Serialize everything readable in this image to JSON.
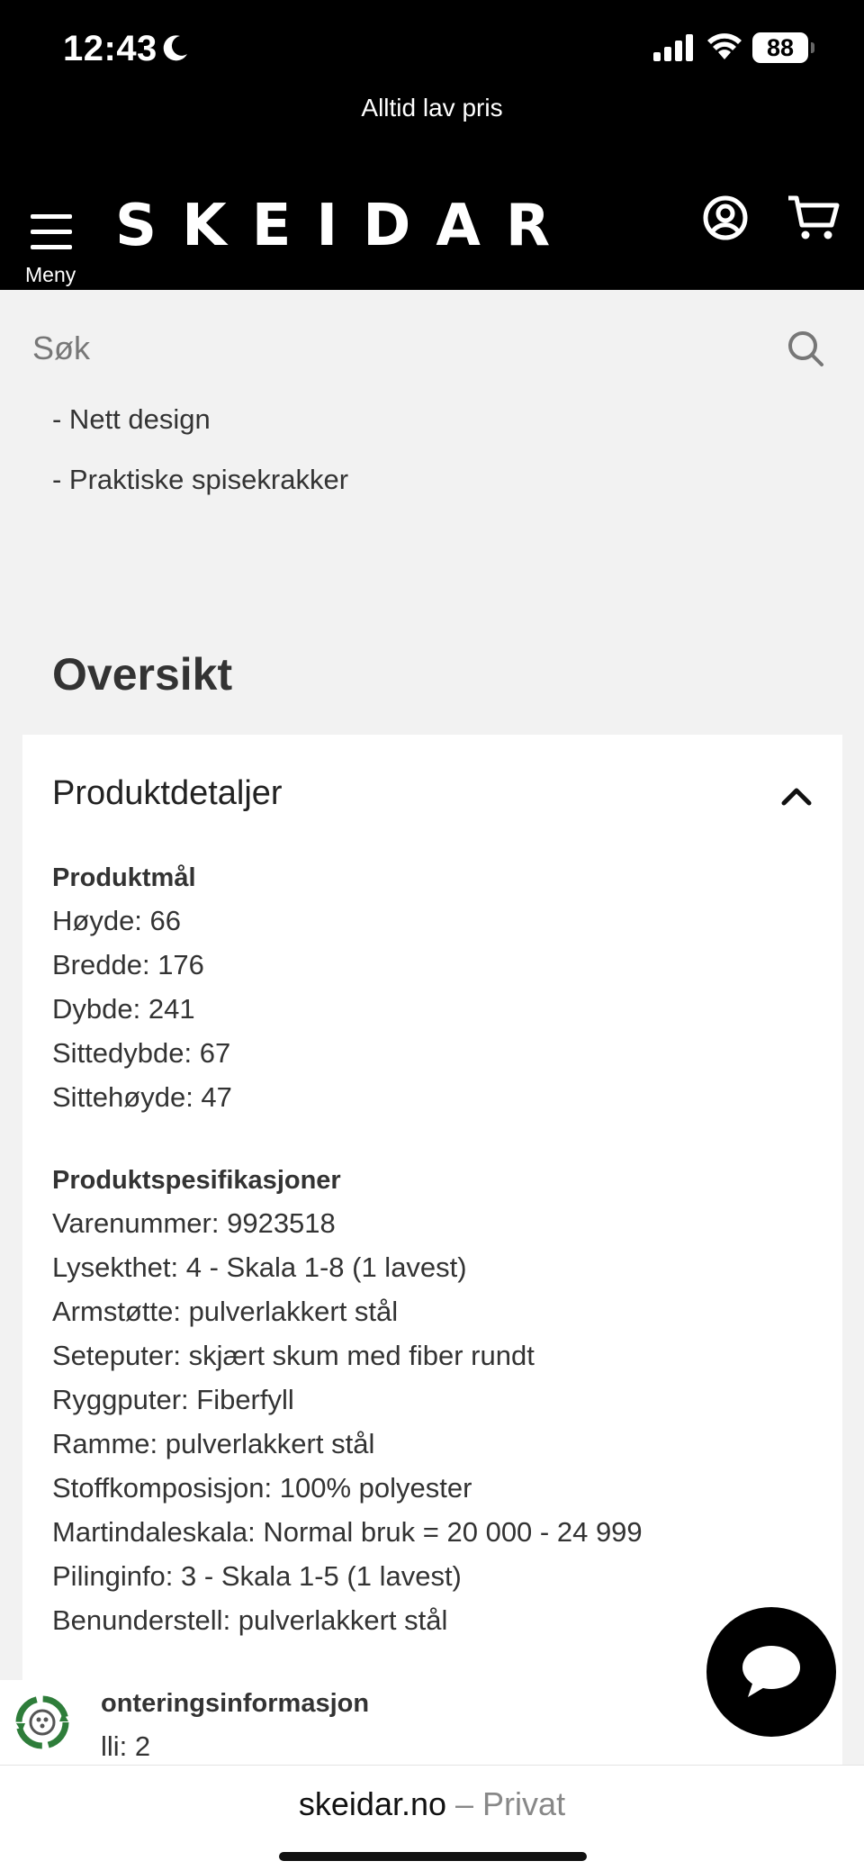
{
  "status_bar": {
    "time": "12:43",
    "battery": "88"
  },
  "announcement": "Alltid lav pris",
  "header": {
    "menu_label": "Meny",
    "logo": "SKEIDAR",
    "account_icon": "account-icon",
    "cart_icon": "cart-icon"
  },
  "search": {
    "placeholder": "Søk",
    "icon": "search-icon"
  },
  "bullets": [
    "- Nett design",
    "- Praktiske spisekrakker"
  ],
  "overview_title": "Oversikt",
  "product_details": {
    "title": "Produktdetaljer",
    "expanded": true,
    "groups": [
      {
        "title": "Produktmål",
        "lines": [
          "Høyde: 66",
          "Bredde: 176",
          "Dybde: 241",
          "Sittedybde: 67",
          "Sittehøyde: 47"
        ]
      },
      {
        "title": "Produktspesifikasjoner",
        "lines": [
          "Varenummer: 9923518",
          "Lysekthet: 4 - Skala 1-8 (1 lavest)",
          "Armstøtte: pulverlakkert stål",
          "Seteputer: skjært skum med fiber rundt",
          "Ryggputer: Fiberfyll",
          "Ramme: pulverlakkert stål",
          "Stoffkomposisjon: 100% polyester",
          "Martindaleskala: Normal bruk = 20 000 - 24 999",
          "Pilinginfo: 3 - Skala 1-5 (1 lavest)",
          "Benunderstell: pulverlakkert stål"
        ]
      },
      {
        "title": "onteringsinformasjon",
        "lines": [
          "lli: 2"
        ]
      }
    ]
  },
  "chat_button_icon": "chat-bubble-icon",
  "recycle_badge_icon": "recycle-icon",
  "browser": {
    "domain": "skeidar.no",
    "separator": " – ",
    "mode": "Privat"
  },
  "colors": {
    "header_bg": "#000000",
    "page_bg": "#f2f2f2",
    "card_bg": "#ffffff",
    "badge_green": "#2e7d3a"
  }
}
